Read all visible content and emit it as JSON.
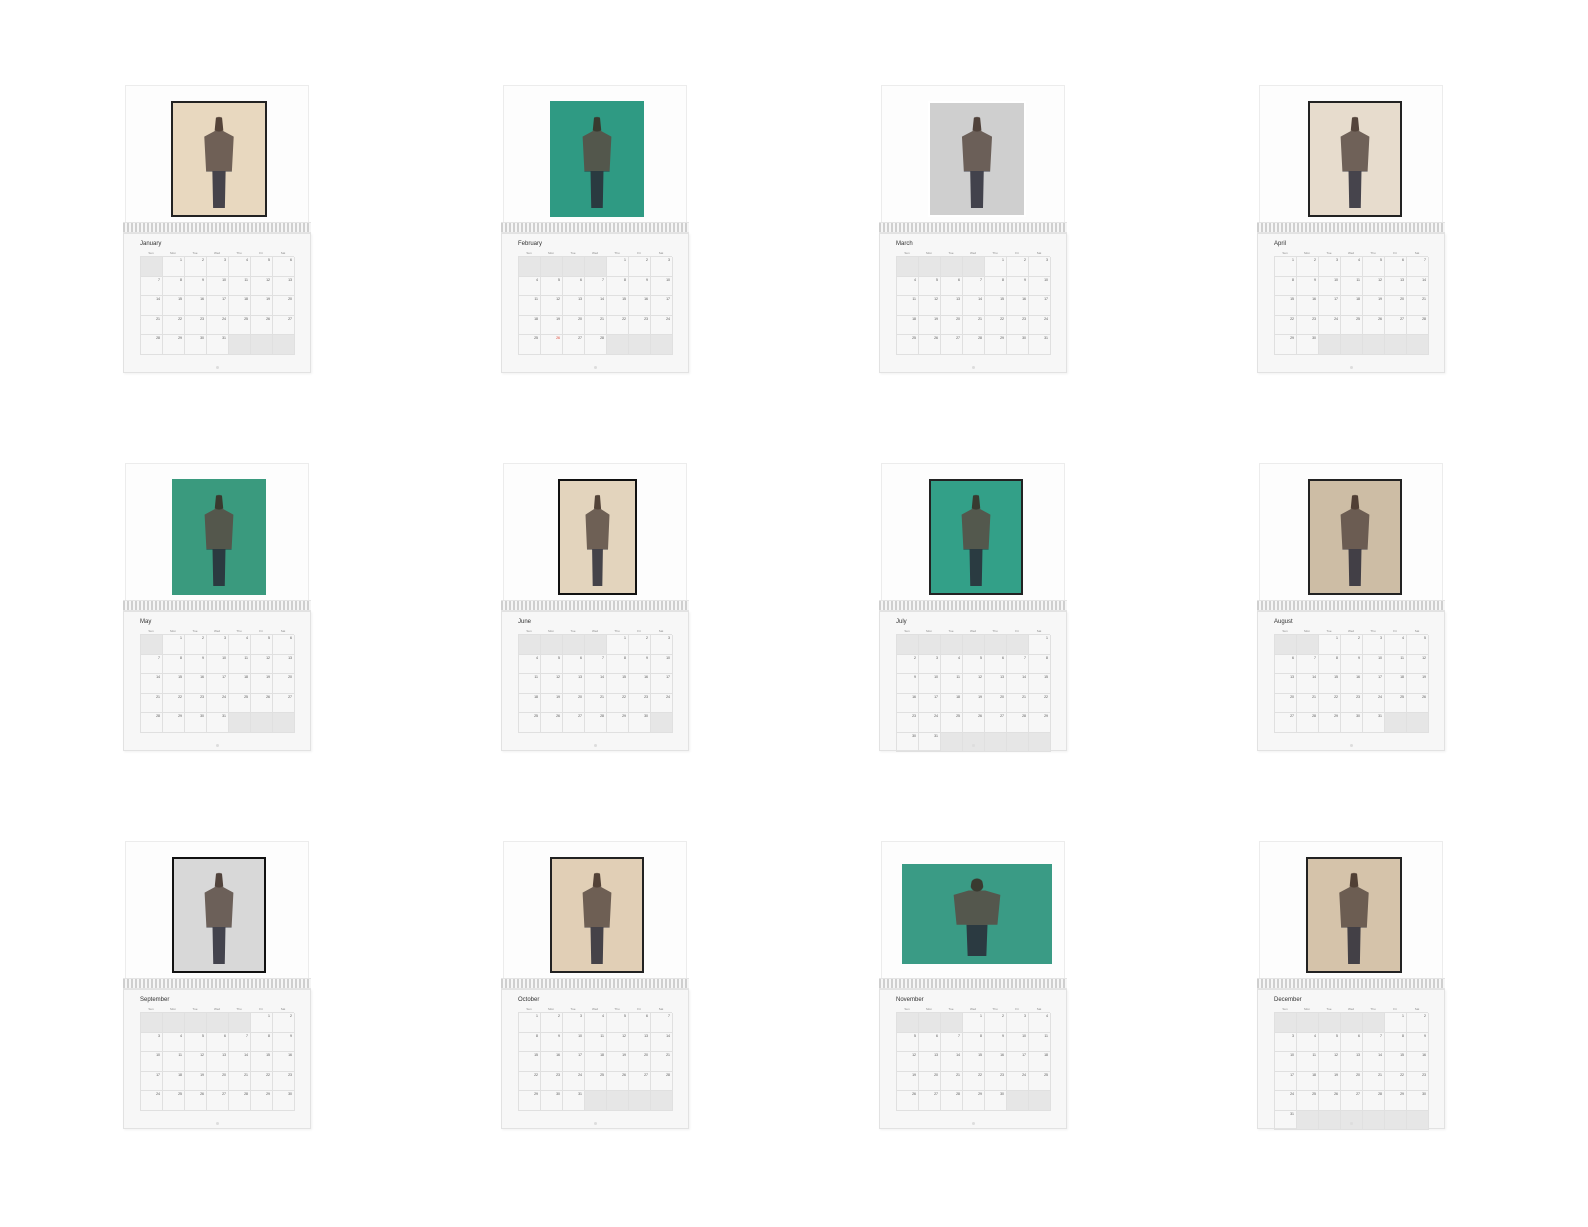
{
  "weekday_labels": [
    "Sun",
    "Mon",
    "Tue",
    "Wed",
    "Thu",
    "Fri",
    "Sat"
  ],
  "months": [
    {
      "name": "January",
      "first_weekday": 1,
      "days": 31,
      "photo_bg": "#e8d8bf",
      "photo_border": "#222222",
      "holiday_days": []
    },
    {
      "name": "February",
      "first_weekday": 4,
      "days": 28,
      "photo_bg": "#2f9a83",
      "photo_border": "#2f9a83",
      "holiday_days": [
        26
      ]
    },
    {
      "name": "March",
      "first_weekday": 4,
      "days": 31,
      "photo_bg": "#cfcfcf",
      "photo_border": "#ffffff",
      "holiday_days": []
    },
    {
      "name": "April",
      "first_weekday": 0,
      "days": 30,
      "photo_bg": "#e7dccd",
      "photo_border": "#222222",
      "holiday_days": []
    },
    {
      "name": "May",
      "first_weekday": 1,
      "days": 31,
      "photo_bg": "#3a9a7e",
      "photo_border": "#3a9a7e",
      "holiday_days": []
    },
    {
      "name": "June",
      "first_weekday": 4,
      "days": 30,
      "photo_bg": "#e3d4bd",
      "photo_border": "#111111",
      "holiday_days": []
    },
    {
      "name": "July",
      "first_weekday": 6,
      "days": 31,
      "photo_bg": "#33a088",
      "photo_border": "#222222",
      "holiday_days": []
    },
    {
      "name": "August",
      "first_weekday": 2,
      "days": 31,
      "photo_bg": "#cdbda5",
      "photo_border": "#222222",
      "holiday_days": []
    },
    {
      "name": "September",
      "first_weekday": 5,
      "days": 30,
      "photo_bg": "#d8d8d8",
      "photo_border": "#111111",
      "holiday_days": []
    },
    {
      "name": "October",
      "first_weekday": 0,
      "days": 31,
      "photo_bg": "#e1cfb6",
      "photo_border": "#222222",
      "holiday_days": []
    },
    {
      "name": "November",
      "first_weekday": 3,
      "days": 30,
      "photo_bg": "#3a9b85",
      "photo_border": "#3a9b85",
      "holiday_days": []
    },
    {
      "name": "December",
      "first_weekday": 5,
      "days": 31,
      "photo_bg": "#d5c3aa",
      "photo_border": "#222222",
      "holiday_days": []
    }
  ]
}
